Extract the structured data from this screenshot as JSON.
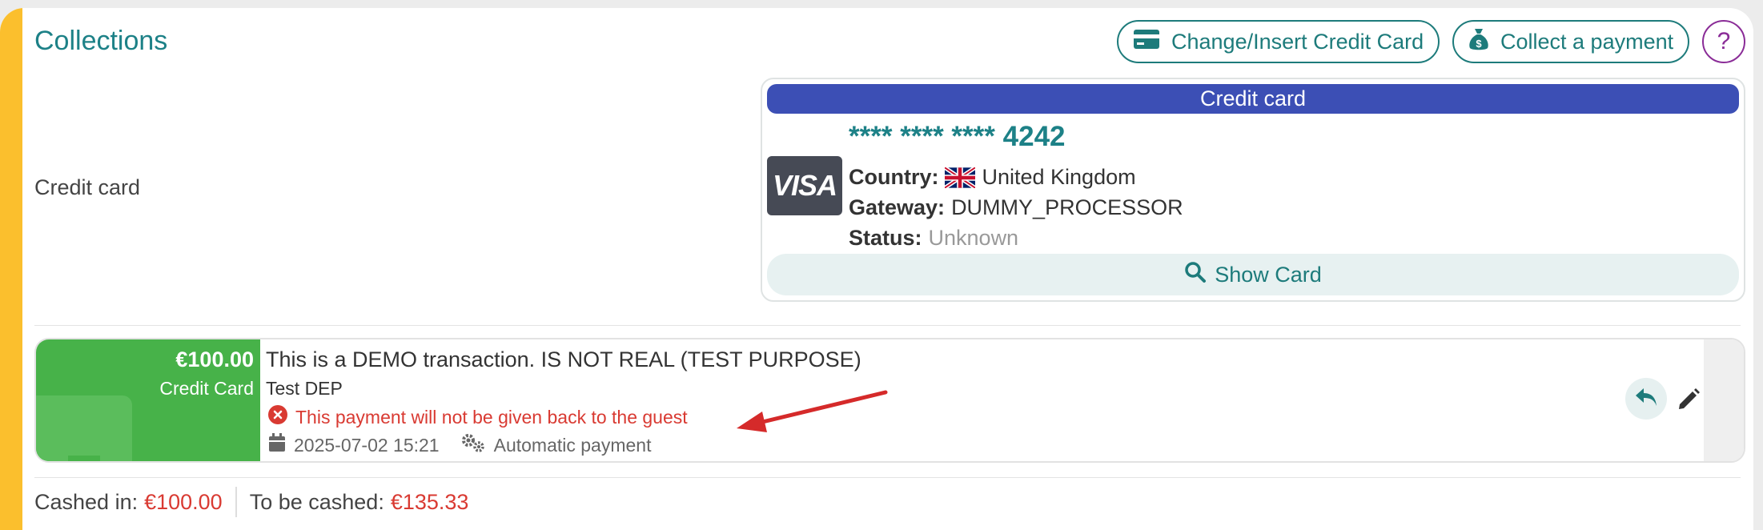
{
  "header": {
    "title": "Collections",
    "change_card_label": "Change/Insert Credit Card",
    "collect_label": "Collect a payment",
    "help_label": "?"
  },
  "credit_card_section": {
    "label": "Credit card",
    "card": {
      "header": "Credit card",
      "brand": "VISA",
      "mask": "**** **** ****",
      "last4": "4242",
      "country_label": "Country:",
      "country_value": "United Kingdom",
      "gateway_label": "Gateway:",
      "gateway_value": "DUMMY_PROCESSOR",
      "status_label": "Status:",
      "status_value": "Unknown",
      "show_card_label": "Show Card"
    }
  },
  "transaction": {
    "amount": "€100.00",
    "method": "Credit Card",
    "title": "This is a DEMO transaction. IS NOT REAL (TEST PURPOSE)",
    "subtitle": "Test DEP",
    "warning": "This payment will not be given back to the guest",
    "datetime": "2025-07-02 15:21",
    "type": "Automatic payment"
  },
  "footer": {
    "cashed_in_label": "Cashed in:",
    "cashed_in_value": "€100.00",
    "to_be_cashed_label": "To be cashed:",
    "to_be_cashed_value": "€135.33"
  },
  "colors": {
    "accent_teal": "#1d8187",
    "stripe_yellow": "#fbbf2d",
    "card_header_blue": "#3c4fb5",
    "tx_green": "#47b249",
    "warning_red": "#d93a32",
    "help_purple": "#8a2c97"
  },
  "icons": {
    "change_card": "credit-card-icon",
    "collect": "money-bag-icon",
    "show_card": "search-icon",
    "warning": "error-circle-icon",
    "date": "calendar-icon",
    "type": "gears-icon",
    "undo": "reply-icon",
    "edit": "pencil-icon",
    "flag": "uk-flag-icon"
  }
}
